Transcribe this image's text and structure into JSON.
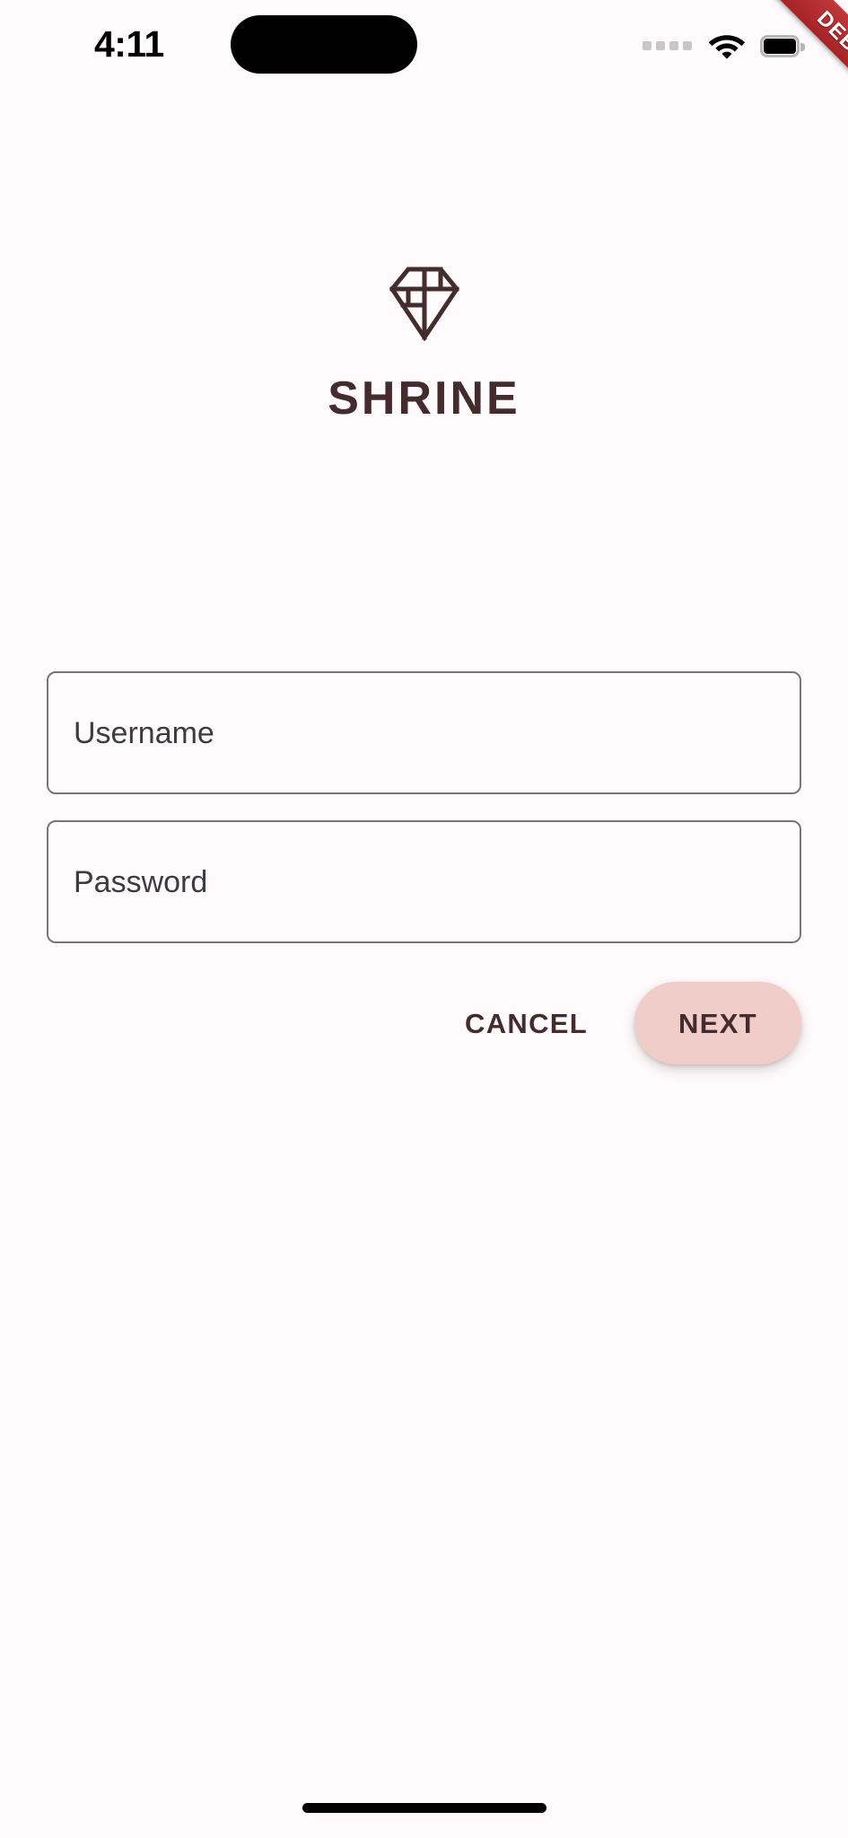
{
  "app": {
    "name": "SHRINE",
    "background_color": "#FFFBFC",
    "primary_color": "#442C2E",
    "accent_color": "#F0CDC9"
  },
  "status_bar": {
    "time": "4:11",
    "icons": {
      "signal": "signal-dots-icon",
      "wifi": "wifi-icon",
      "battery": "battery-full-icon"
    },
    "notch": "dynamic-island"
  },
  "debug_banner": {
    "label": "DEBUG",
    "color": "#B4292E",
    "text_color": "#FFFFFF",
    "position": "top-right"
  },
  "brand": {
    "logo_name": "shrine-diamond-logo",
    "logo_color": "#442C2E",
    "title": "SHRINE"
  },
  "form": {
    "fields": [
      {
        "name": "username",
        "label": "Username",
        "value": "",
        "placeholder": "Username",
        "type": "text"
      },
      {
        "name": "password",
        "label": "Password",
        "value": "",
        "placeholder": "Password",
        "type": "password"
      }
    ]
  },
  "actions": {
    "cancel_label": "CANCEL",
    "next_label": "NEXT"
  },
  "home_indicator": {
    "name": "home-indicator-bar"
  }
}
